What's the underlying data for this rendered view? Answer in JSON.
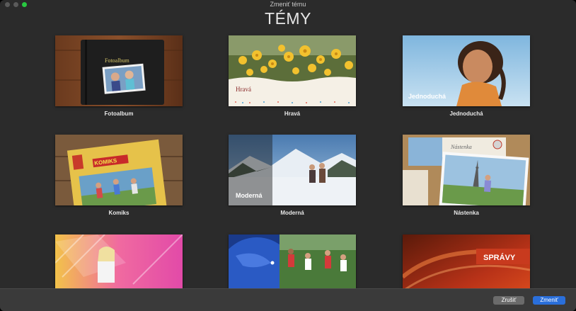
{
  "window": {
    "title": "Zmeniť tému"
  },
  "heading": "TÉMY",
  "themes": [
    {
      "label": "Fotoalbum",
      "overlay": "Fotoalbum"
    },
    {
      "label": "Hravá",
      "overlay": "Hravá"
    },
    {
      "label": "Jednoduchá",
      "overlay": "Jednoduchá"
    },
    {
      "label": "Komiks",
      "overlay": "KOMIKS"
    },
    {
      "label": "Moderná",
      "overlay": "Moderná"
    },
    {
      "label": "Nástenka",
      "overlay": "Nástenka"
    },
    {
      "label": "",
      "overlay": ""
    },
    {
      "label": "",
      "overlay": ""
    },
    {
      "label": "",
      "overlay": "SPRÁVY"
    }
  ],
  "buttons": {
    "cancel": "Zrušiť",
    "change": "Zmeniť"
  },
  "colors": {
    "accent": "#2a6fdb",
    "background": "#2b2b2b"
  }
}
